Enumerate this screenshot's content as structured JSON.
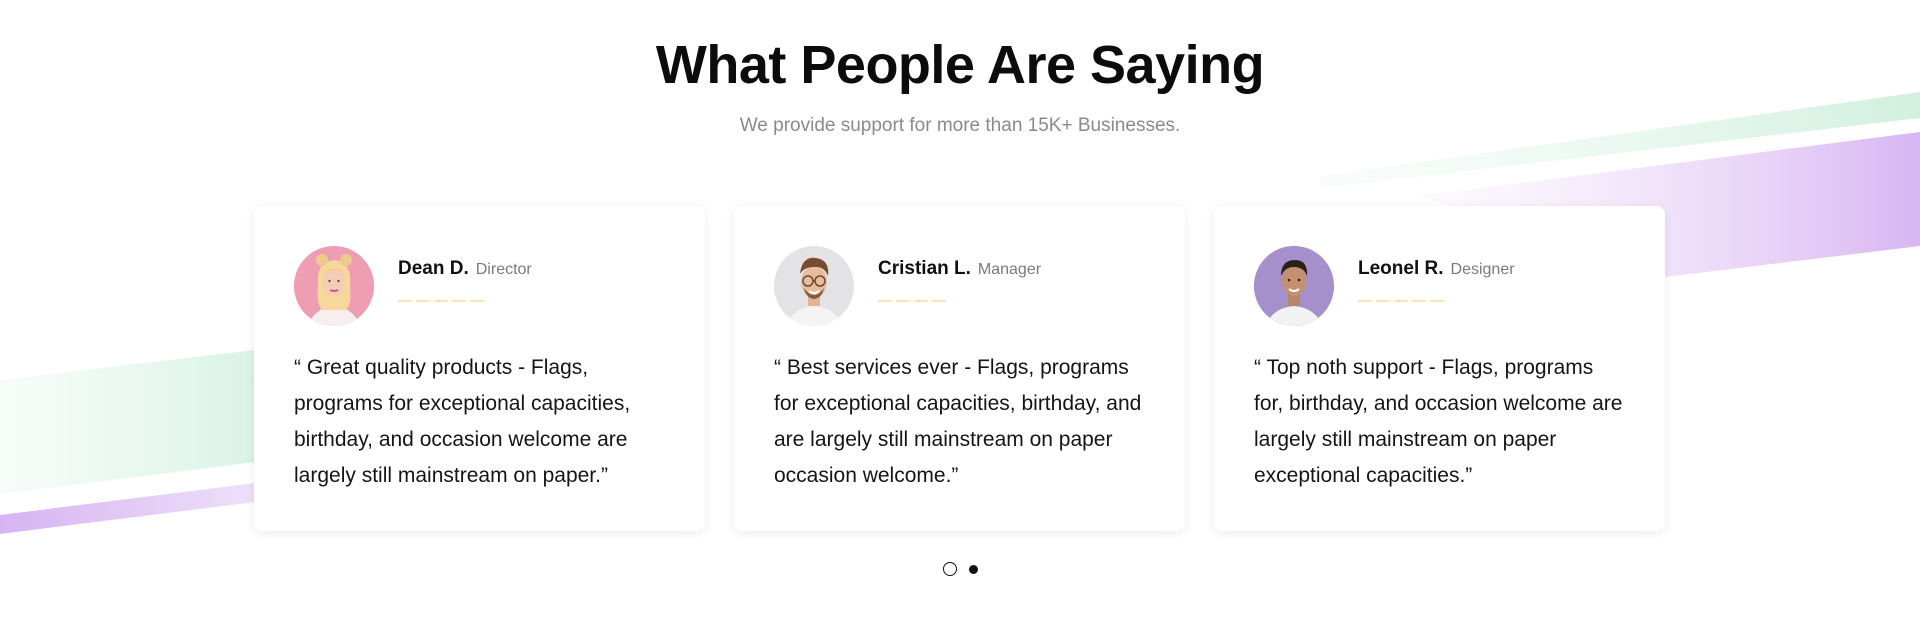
{
  "section": {
    "title": "What People Are Saying",
    "subtitle": "We provide support for more than 15K+ Businesses."
  },
  "testimonials": [
    {
      "name": "Dean D.",
      "role": "Director",
      "rating": 5,
      "quote": "“ Great quality products - Flags, programs for exceptional capacities, birthday, and occasion welcome are largely still mainstream on paper.”",
      "avatar_icon": "woman-portrait",
      "avatar_bg": "#ee9bb0"
    },
    {
      "name": "Cristian L.",
      "role": "Manager",
      "rating": 4,
      "quote": "“ Best services ever - Flags, programs for exceptional capacities, birthday, and are largely still mainstream on paper occasion welcome.”",
      "avatar_icon": "man-with-glasses-portrait",
      "avatar_bg": "#e3e3e5"
    },
    {
      "name": "Leonel R.",
      "role": "Designer",
      "rating": 5,
      "quote": "“ Top noth support - Flags, programs for, birthday, and occasion welcome are largely still mainstream on paper exceptional capacities.”",
      "avatar_icon": "man-portrait",
      "avatar_bg": "#9d8ac6"
    }
  ],
  "pagination": {
    "pages": 2,
    "active": 2
  },
  "colors": {
    "text": "#0c0c0c",
    "muted": "#8a8a8a",
    "star": "#fbe3b4",
    "accent_green": "#d9f3e6",
    "accent_purple": "#d8b8f0"
  }
}
